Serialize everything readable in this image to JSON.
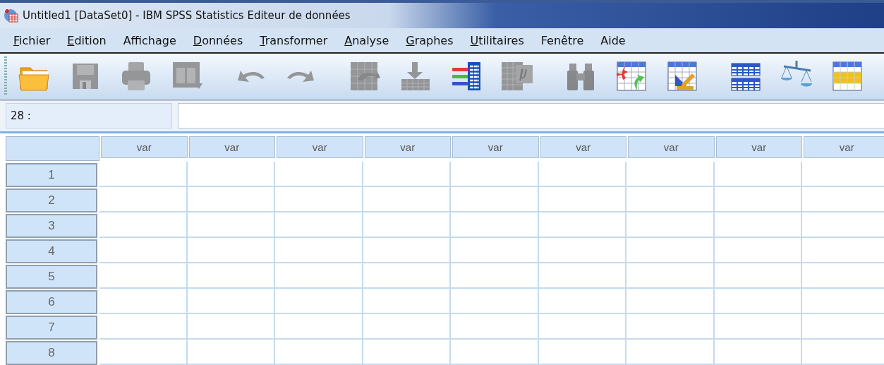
{
  "window": {
    "title": "Untitled1 [DataSet0] - IBM SPSS Statistics Editeur de données"
  },
  "menu": [
    {
      "label": "Fichier",
      "mnemonic": true
    },
    {
      "label": "Edition",
      "mnemonic": true
    },
    {
      "label": "Affichage",
      "mnemonic": false
    },
    {
      "label": "Données",
      "mnemonic": true
    },
    {
      "label": "Transformer",
      "mnemonic": true
    },
    {
      "label": "Analyse",
      "mnemonic": true
    },
    {
      "label": "Graphes",
      "mnemonic": true
    },
    {
      "label": "Utilitaires",
      "mnemonic": true
    },
    {
      "label": "Fenêtre",
      "mnemonic": false
    },
    {
      "label": "Aide",
      "mnemonic": false
    }
  ],
  "toolbar": [
    {
      "kind": "open",
      "disabled": false
    },
    {
      "kind": "save",
      "disabled": true
    },
    {
      "kind": "print",
      "disabled": true
    },
    {
      "kind": "dialog",
      "disabled": true
    },
    {
      "kind": "undo",
      "disabled": true
    },
    {
      "kind": "redo",
      "disabled": true
    },
    {
      "kind": "goto-case",
      "disabled": true
    },
    {
      "kind": "goto-variable",
      "disabled": true
    },
    {
      "kind": "variables",
      "disabled": false
    },
    {
      "kind": "statistics",
      "disabled": true
    },
    {
      "kind": "find",
      "disabled": true
    },
    {
      "kind": "insert-cases",
      "disabled": false
    },
    {
      "kind": "insert-variable",
      "disabled": false
    },
    {
      "kind": "split",
      "disabled": false
    },
    {
      "kind": "weight",
      "disabled": false
    },
    {
      "kind": "select",
      "disabled": false
    }
  ],
  "cell_editor": {
    "cell_ref": "28 :"
  },
  "grid": {
    "columns": [
      "var",
      "var",
      "var",
      "var",
      "var",
      "var",
      "var",
      "var",
      "var"
    ],
    "rows": [
      "1",
      "2",
      "3",
      "4",
      "5",
      "6",
      "7",
      "8"
    ]
  }
}
